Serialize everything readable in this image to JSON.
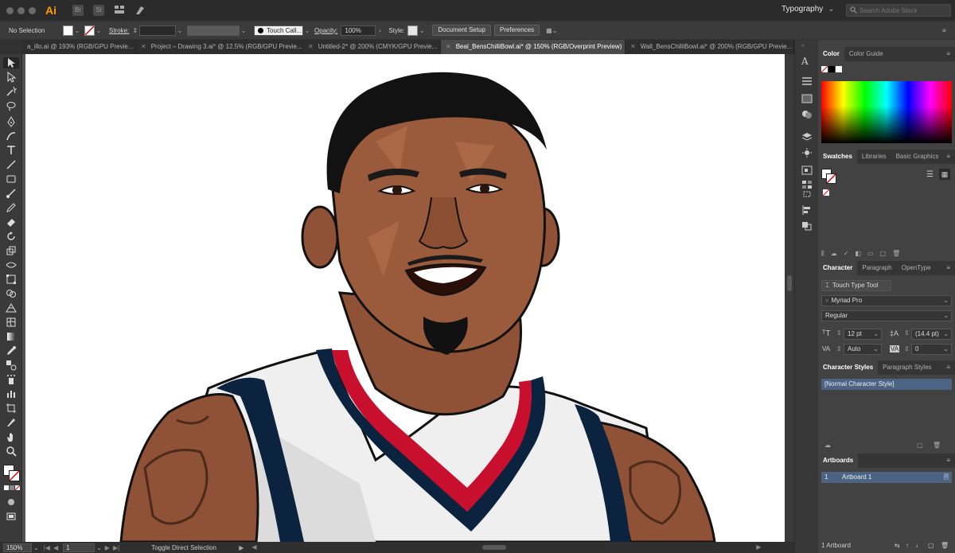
{
  "app": {
    "logo": "Ai",
    "bridge_icon": "Br",
    "stock_icon": "St",
    "workspace": "Typography",
    "search_placeholder": "Search Adobe Stock"
  },
  "control_bar": {
    "selection": "No Selection",
    "stroke_label": "Stroke:",
    "brush": "Touch Call...",
    "opacity_label": "Opacity:",
    "opacity_value": "100%",
    "style_label": "Style:",
    "document_setup": "Document Setup",
    "preferences": "Preferences"
  },
  "tabs": [
    {
      "label": "a_illo.ai @ 193% (RGB/GPU Previe...",
      "active": false
    },
    {
      "label": "Project – Drawing 3.ai* @ 12.5% (RGB/GPU Previe...",
      "active": false
    },
    {
      "label": "Untitled-2* @ 200% (CMYK/GPU Previe...",
      "active": false
    },
    {
      "label": "Beal_BensChilliBowl.ai* @ 150% (RGB/Overprint Preview)",
      "active": true
    },
    {
      "label": "Wall_BensChilliBowl.ai* @ 200% (RGB/GPU Previe...",
      "active": false
    }
  ],
  "status_bar": {
    "zoom": "150%",
    "artboard_number": "1",
    "tool_hint": "Toggle Direct Selection"
  },
  "color_panel": {
    "tabs": [
      "Color",
      "Color Guide"
    ]
  },
  "swatches_panel": {
    "tabs": [
      "Swatches",
      "Libraries",
      "Basic Graphics"
    ]
  },
  "character_panel": {
    "tabs": [
      "Character",
      "Paragraph",
      "OpenType"
    ],
    "touch_type_tool": "Touch Type Tool",
    "font_family": "Myriad Pro",
    "font_style": "Regular",
    "font_size": "12 pt",
    "leading": "(14.4 pt)",
    "kerning": "Auto",
    "tracking": "0"
  },
  "character_styles_panel": {
    "tabs": [
      "Character Styles",
      "Paragraph Styles"
    ],
    "styles": [
      "[Normal Character Style]"
    ]
  },
  "artboards_panel": {
    "tabs": [
      "Artboards"
    ],
    "items": [
      {
        "number": "1",
        "name": "Artboard 1"
      }
    ],
    "count": "1 Artboard"
  },
  "colors": {
    "accent": "#ff9a00",
    "panel_bg": "#424242",
    "jersey_red": "#c8102e",
    "jersey_navy": "#0c2340",
    "skin": "#9a5a3c"
  }
}
